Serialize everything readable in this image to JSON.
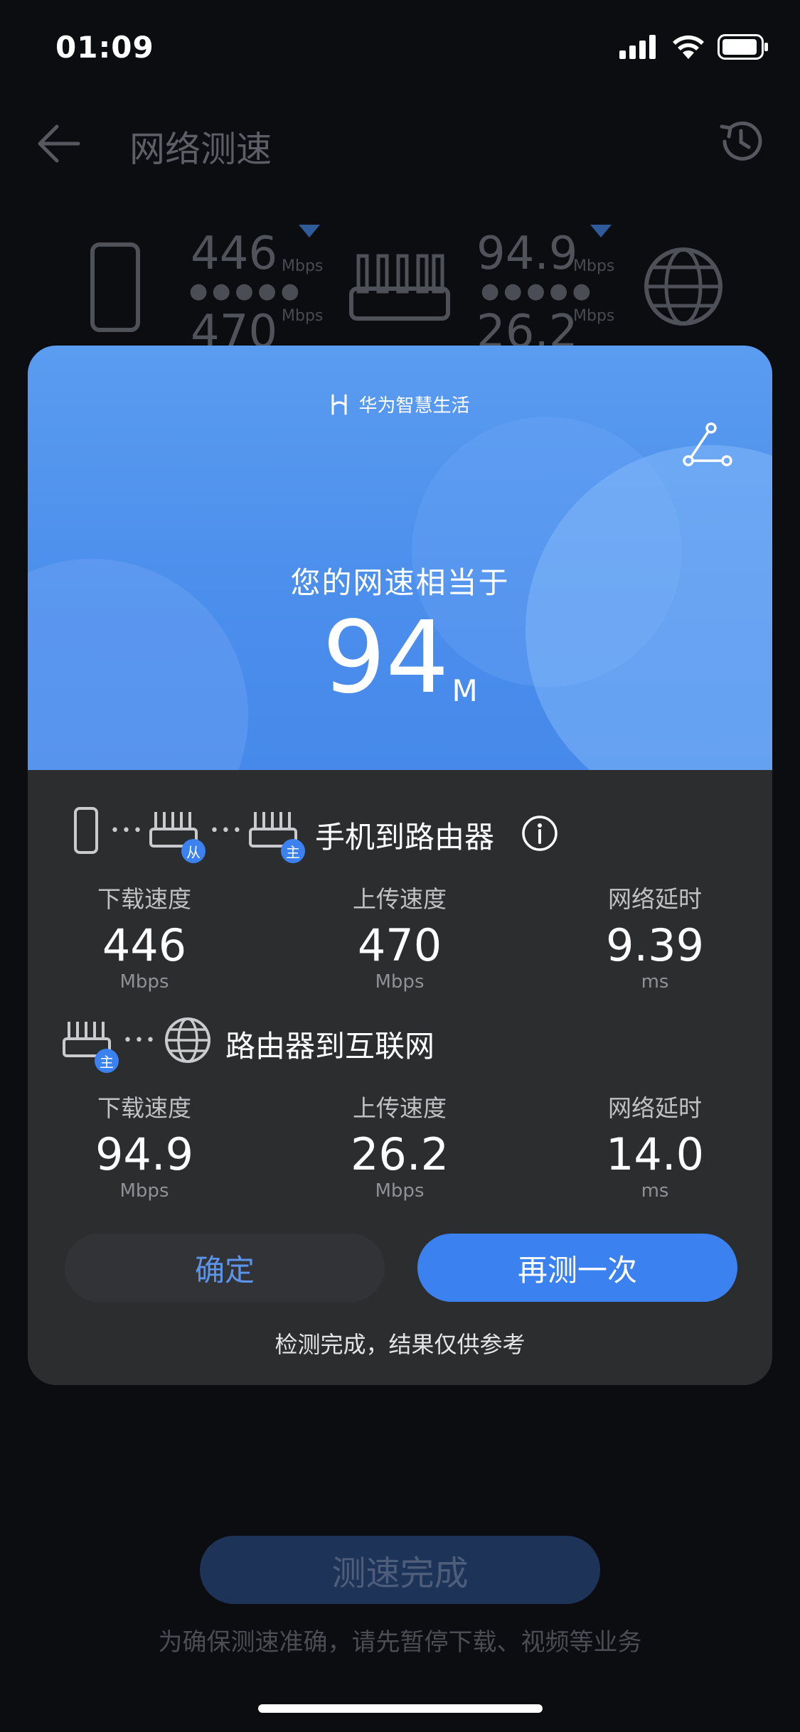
{
  "status_bar": {
    "time": "01:09"
  },
  "header": {
    "title": "网络测速"
  },
  "background_topology": {
    "phone_download": "446",
    "phone_upload": "470",
    "internet_download": "94.9",
    "internet_upload": "26.2",
    "unit": "Mbps"
  },
  "modal": {
    "brand": "华为智慧生活",
    "hero_label": "您的网速相当于",
    "hero_value": "94",
    "hero_unit": "M",
    "phone_to_router": {
      "title": "手机到路由器",
      "badge_secondary": "从",
      "badge_primary": "主",
      "metrics": [
        {
          "label": "下载速度",
          "value": "446",
          "unit": "Mbps"
        },
        {
          "label": "上传速度",
          "value": "470",
          "unit": "Mbps"
        },
        {
          "label": "网络延时",
          "value": "9.39",
          "unit": "ms"
        }
      ]
    },
    "router_to_internet": {
      "title": "路由器到互联网",
      "badge_primary": "主",
      "metrics": [
        {
          "label": "下载速度",
          "value": "94.9",
          "unit": "Mbps"
        },
        {
          "label": "上传速度",
          "value": "26.2",
          "unit": "Mbps"
        },
        {
          "label": "网络延时",
          "value": "14.0",
          "unit": "ms"
        }
      ]
    },
    "confirm_label": "确定",
    "retest_label": "再测一次",
    "footer_note": "检测完成，结果仅供参考"
  },
  "bottom": {
    "button_label": "测速完成",
    "tip": "为确保测速准确，请先暂停下载、视频等业务"
  },
  "colors": {
    "accent": "#3b82f0",
    "hero_blue": "#4b8eec",
    "modal_bg": "#2c2d2f",
    "page_bg": "#0c0d10"
  }
}
